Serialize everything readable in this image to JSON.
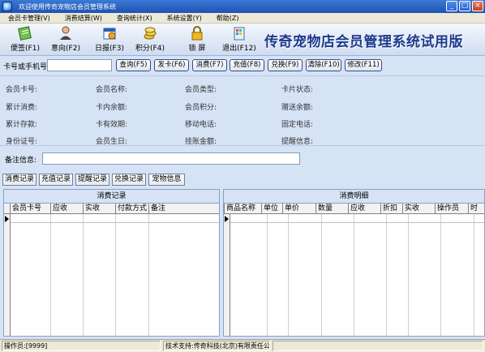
{
  "window": {
    "title": "欢迎使用传奇宠物店会员管理系统",
    "controls": [
      "_",
      "□",
      "×"
    ]
  },
  "menu": [
    "会员卡管理(V)",
    "消费结算(W)",
    "查询统计(X)",
    "系统设置(Y)",
    "帮助(Z)"
  ],
  "toolbar": {
    "buttons": [
      {
        "label": "便签(F1)",
        "icon": "notepad-icon"
      },
      {
        "label": "意向(F2)",
        "icon": "person-icon"
      },
      {
        "label": "日报(F3)",
        "icon": "calendar-report-icon"
      },
      {
        "label": "积分(F4)",
        "icon": "coins-icon"
      },
      {
        "label": "锁  屏",
        "icon": "lock-icon"
      },
      {
        "label": "退出(F12)",
        "icon": "exit-icon"
      }
    ],
    "brand": "传奇宠物店会员管理系统试用版"
  },
  "search": {
    "label": "卡号或手机号",
    "value": "",
    "buttons": [
      "查询(F5)",
      "发卡(F6)",
      "消费(F7)",
      "充值(F8)",
      "兑换(F9)",
      "清除(F10)",
      "修改(F11)"
    ]
  },
  "info": {
    "fields": [
      "会员卡号:",
      "会员名称:",
      "会员类型:",
      "卡片状态:",
      "累计消费:",
      "卡内余额:",
      "会员积分:",
      "赠送余额:",
      "累计存款:",
      "卡有效期:",
      "移动电话:",
      "固定电话:",
      "身份证号:",
      "会员生日:",
      "挂账金额:",
      "提醒信息:"
    ]
  },
  "memo": {
    "label": "备注信息:",
    "value": ""
  },
  "tabs": [
    "消费记录",
    "充值记录",
    "提醒记录",
    "兑换记录",
    "宠物信息"
  ],
  "left_grid": {
    "caption": "消费记录",
    "columns": [
      "会员卡号",
      "应收",
      "实收",
      "付款方式",
      "备注"
    ]
  },
  "right_grid": {
    "caption": "消费明细",
    "columns": [
      "商品名称",
      "单位",
      "单价",
      "数量",
      "应收",
      "折扣",
      "实收",
      "操作员",
      "时"
    ]
  },
  "status": {
    "operator": "操作员:[9999]",
    "support": "技术支持:传奇科技(北京)有限责任公司"
  },
  "colors": {
    "brand": "#1c3a8c",
    "titlebar": "#1f52b3"
  }
}
